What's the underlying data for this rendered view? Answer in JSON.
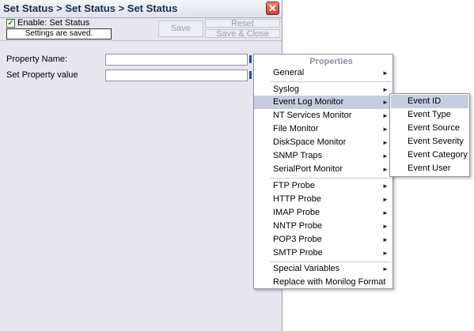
{
  "window": {
    "title": "Set Status > Set Status > Set Status",
    "close_glyph": "✕"
  },
  "toolbar": {
    "enable_label": "Enable: Set Status",
    "enable_checked": true,
    "status_text": "Settings are saved.",
    "save_label": "Save",
    "reset_label": "Reset",
    "save_close_label": "Save & Close"
  },
  "form": {
    "property_name_label": "Property Name:",
    "property_name_value": "",
    "property_value_label": "Set Property value",
    "property_value_value": ""
  },
  "menu": {
    "header": "Properties",
    "arrow": "►",
    "items": [
      {
        "label": "General",
        "submenu": true
      },
      {
        "label": "Syslog",
        "submenu": true
      },
      {
        "label": "Event Log Monitor",
        "submenu": true,
        "highlighted": true
      },
      {
        "label": "NT Services Monitor",
        "submenu": true
      },
      {
        "label": "File Monitor",
        "submenu": true
      },
      {
        "label": "DiskSpace Monitor",
        "submenu": true
      },
      {
        "label": "SNMP Traps",
        "submenu": true
      },
      {
        "label": "SerialPort Monitor",
        "submenu": true
      },
      {
        "label": "FTP Probe",
        "submenu": true
      },
      {
        "label": "HTTP Probe",
        "submenu": true
      },
      {
        "label": "IMAP Probe",
        "submenu": true
      },
      {
        "label": "NNTP Probe",
        "submenu": true
      },
      {
        "label": "POP3 Probe",
        "submenu": true
      },
      {
        "label": "SMTP Probe",
        "submenu": true
      },
      {
        "label": "Special Variables",
        "submenu": true
      },
      {
        "label": "Replace with Monilog Format",
        "submenu": false
      }
    ]
  },
  "submenu": {
    "items": [
      {
        "label": "Event ID",
        "highlighted": true
      },
      {
        "label": "Event Type"
      },
      {
        "label": "Event Source"
      },
      {
        "label": "Event Severity"
      },
      {
        "label": "Event Category"
      },
      {
        "label": "Event User"
      }
    ]
  },
  "colors": {
    "dialog_bg": "#e7e6ee",
    "highlight": "#c7cde0",
    "title_text": "#1d2a55",
    "close_button": "#c8442d"
  }
}
